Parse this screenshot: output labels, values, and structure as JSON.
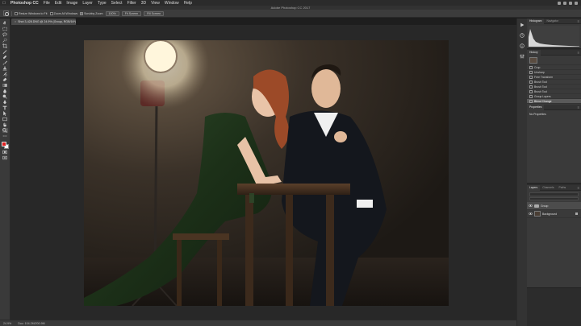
{
  "menubar": {
    "app": "Photoshop CC",
    "items": [
      "File",
      "Edit",
      "Image",
      "Layer",
      "Type",
      "Select",
      "Filter",
      "3D",
      "View",
      "Window",
      "Help"
    ]
  },
  "window": {
    "title": "Adobe Photoshop CC 2017"
  },
  "options": {
    "resize_windows": "Resize Windows to Fit",
    "zoom_all": "Zoom All Windows",
    "scrubby_zoom": "Scrubby Zoom",
    "zoom_100": "100%",
    "fit_screen": "Fit Screen",
    "fill_screen": "Fill Screen"
  },
  "document": {
    "tab_title": "Shot 3-428.DNG @ 24.9% (Group, RGB/16*)",
    "zoom": "24.9%",
    "doc_size": "Doc: 104.2M/200.9M"
  },
  "panels": {
    "histogram": {
      "tabs": [
        "Histogram",
        "Navigator"
      ]
    },
    "history": {
      "title": "History",
      "items": [
        "Crop",
        "Unsharp",
        "Free Transform",
        "Brush Tool",
        "Brush Tool",
        "Brush Tool",
        "Group Layers",
        "Blend Change"
      ]
    },
    "properties": {
      "title": "Properties",
      "empty_text": "No Properties"
    },
    "layers": {
      "tabs": [
        "Layers",
        "Channels",
        "Paths"
      ],
      "items": [
        {
          "name": "Group"
        },
        {
          "name": "Background"
        }
      ]
    }
  }
}
